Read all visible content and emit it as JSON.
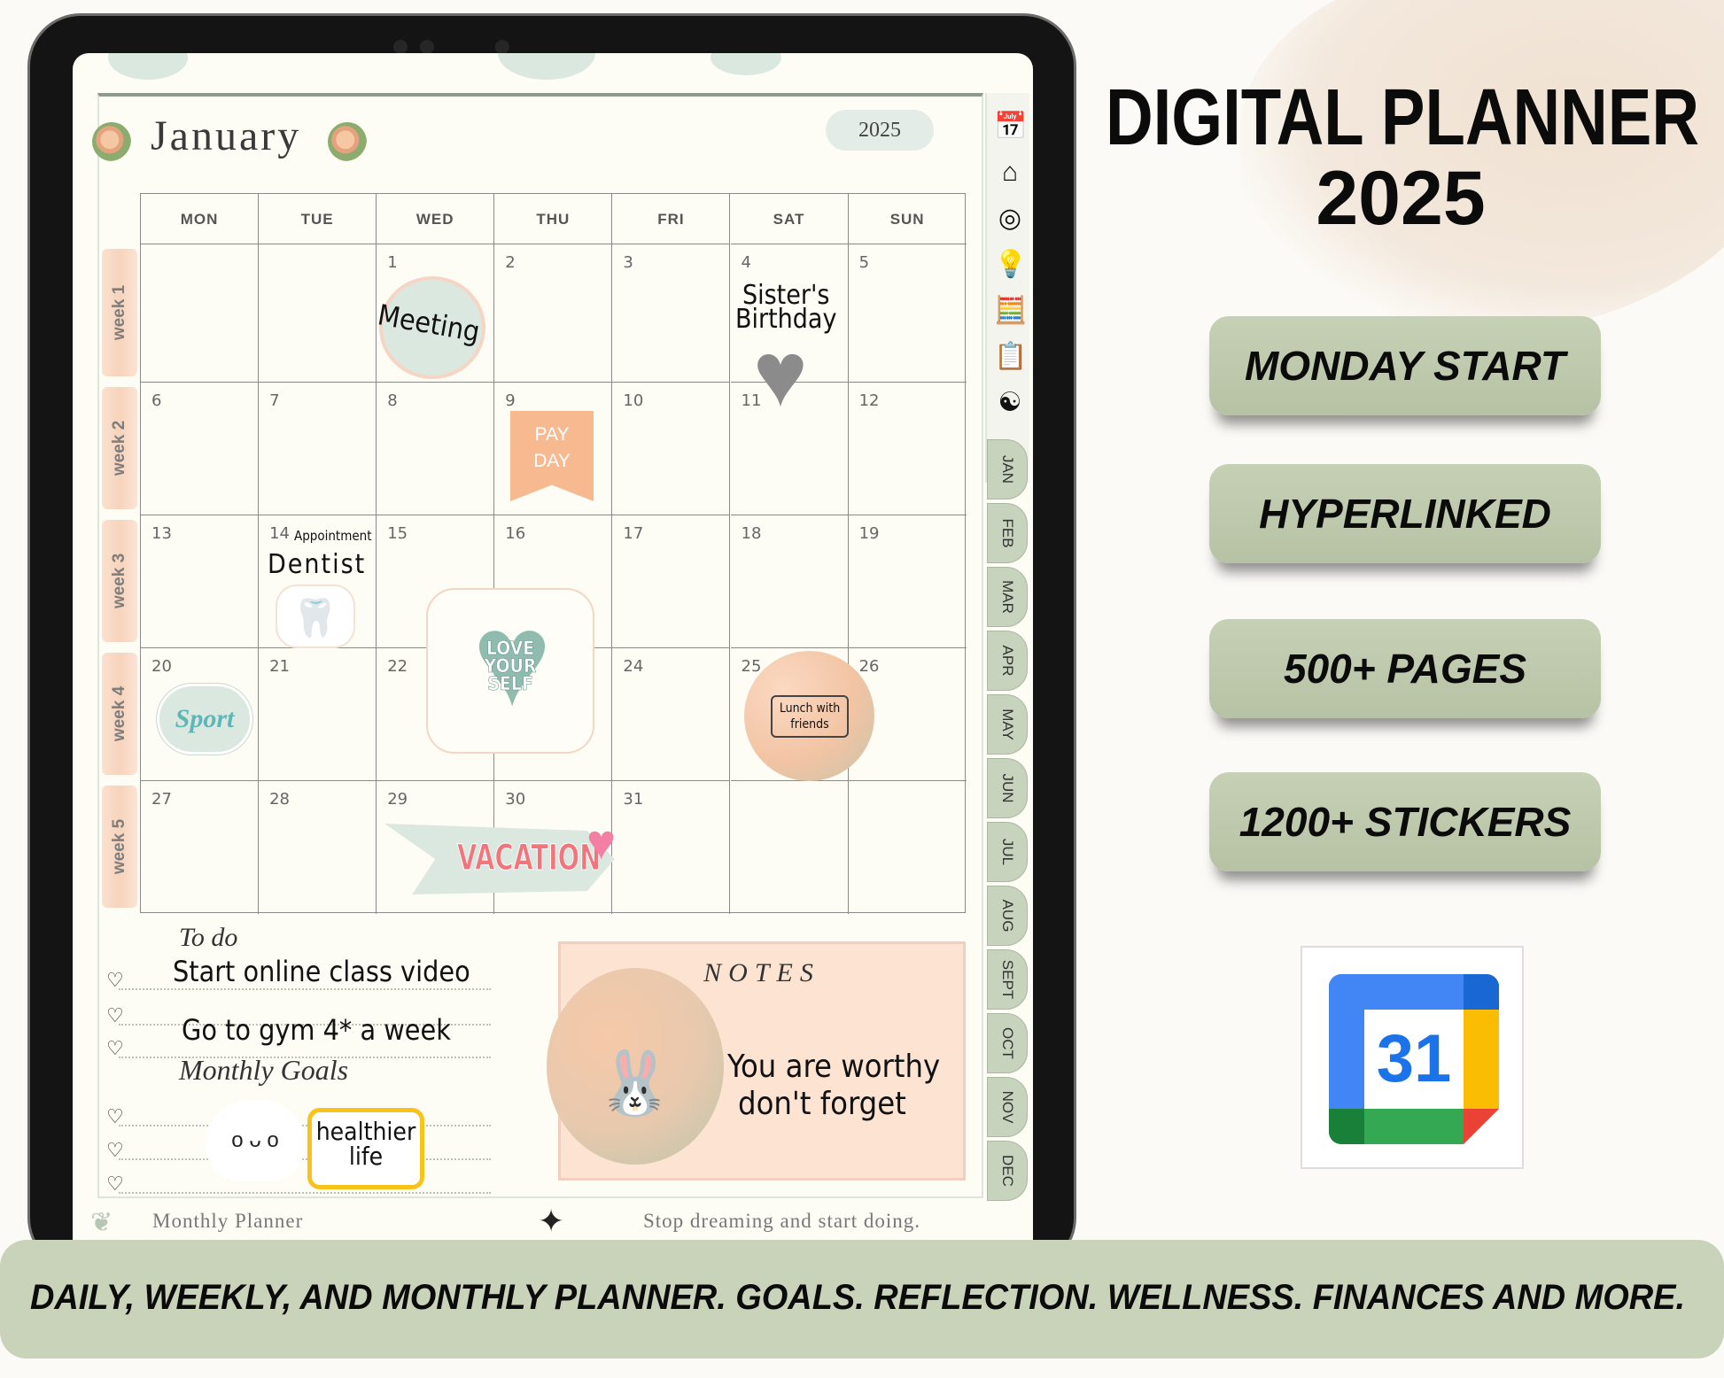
{
  "planner": {
    "month": "January",
    "year": "2025",
    "weekdays": [
      "MON",
      "TUE",
      "WED",
      "THU",
      "FRI",
      "SAT",
      "SUN"
    ],
    "weeks": [
      {
        "label": "week 1",
        "days": [
          "",
          "",
          "1",
          "2",
          "3",
          "4",
          "5"
        ]
      },
      {
        "label": "week 2",
        "days": [
          "6",
          "7",
          "8",
          "9",
          "10",
          "11",
          "12"
        ]
      },
      {
        "label": "week 3",
        "days": [
          "13",
          "14",
          "15",
          "16",
          "17",
          "18",
          "19"
        ]
      },
      {
        "label": "week 4",
        "days": [
          "20",
          "21",
          "22",
          "",
          "24",
          "25",
          "26"
        ]
      },
      {
        "label": "week 5",
        "days": [
          "27",
          "28",
          "29",
          "30",
          "31",
          "",
          ""
        ]
      }
    ],
    "stickers": {
      "meeting": "Meeting",
      "sisters_birthday": [
        "Sister's",
        "Birthday"
      ],
      "pay_day": [
        "PAY",
        "DAY"
      ],
      "appointment": "Appointment",
      "dentist": "Dentist",
      "love_yourself": [
        "LOVE",
        "YOUR",
        "SELF"
      ],
      "sport": "Sport",
      "lunch": [
        "Lunch with",
        "friends"
      ],
      "vacation": "VACATION"
    },
    "todo": {
      "title": "To do",
      "items": [
        "Start online class video",
        "",
        "Go to gym 4* a week"
      ],
      "goals_title": "Monthly Goals",
      "goal_sticker": [
        "healthier",
        "life"
      ]
    },
    "notes": {
      "title": "NOTES",
      "text": [
        "You are worthy",
        "don't forget"
      ]
    },
    "footer": {
      "left": "Monthly Planner",
      "right": "Stop dreaming and start doing."
    },
    "side_icons": [
      "calendar-icon",
      "home-heart-icon",
      "target-icon",
      "lightbulb-puzzle-icon",
      "finance-calculator-icon",
      "notes-clipboard-icon",
      "wellness-icon"
    ],
    "month_tabs": [
      "JAN",
      "FEB",
      "MAR",
      "APR",
      "MAY",
      "JUN",
      "JUL",
      "AUG",
      "SEPT",
      "OCT",
      "NOV",
      "DEC"
    ]
  },
  "promo": {
    "title": "DIGITAL PLANNER",
    "year": "2025",
    "features": [
      "MONDAY START",
      "HYPERLINKED",
      "500+ PAGES",
      "1200+ STICKERS"
    ],
    "app_icon_number": "31",
    "banner": "DAILY, WEEKLY, AND MONTHLY PLANNER. GOALS. REFLECTION. WELLNESS. FINANCES AND MORE."
  },
  "colors": {
    "accent_green": "#c8d3b9",
    "peach": "#f7b98f",
    "mint": "#dbe8df"
  }
}
